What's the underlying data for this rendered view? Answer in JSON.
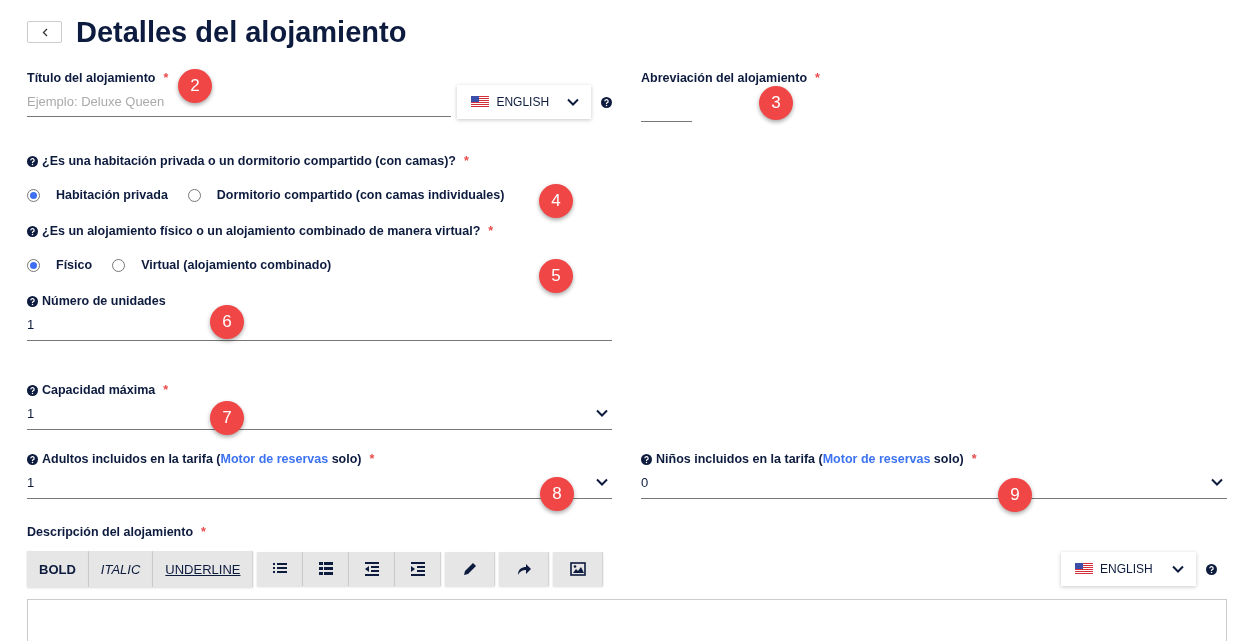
{
  "page": {
    "title": "Detalles del alojamiento"
  },
  "title_field": {
    "label": "Título del alojamiento",
    "required_mark": "*",
    "placeholder": "Ejemplo: Deluxe Queen",
    "language": "ENGLISH",
    "help_icon": true
  },
  "abbreviation_field": {
    "label": "Abreviación del alojamiento",
    "required_mark": "*"
  },
  "room_type": {
    "question": "¿Es una habitación privada o un dormitorio compartido (con camas)?",
    "required_mark": "*",
    "help_icon": true,
    "options": [
      {
        "label": "Habitación privada",
        "selected": true
      },
      {
        "label": "Dormitorio compartido (con camas individuales)",
        "selected": false
      }
    ]
  },
  "accommodation_type": {
    "question": "¿Es un alojamiento físico o un alojamiento combinado de manera virtual?",
    "required_mark": "*",
    "help_icon": true,
    "options": [
      {
        "label": "Físico",
        "selected": true
      },
      {
        "label": "Virtual (alojamiento combinado)",
        "selected": false
      }
    ]
  },
  "units_field": {
    "label": "Número de unidades",
    "help_icon": true,
    "value": "1"
  },
  "capacity_select": {
    "label": "Capacidad máxima",
    "required_mark": "*",
    "help_icon": true,
    "value": "1"
  },
  "adults_select": {
    "label_before": "Adultos incluidos en la tarifa (",
    "link": "Motor de reservas",
    "label_after": " solo)",
    "required_mark": "*",
    "help_icon": true,
    "value": "1"
  },
  "children_select": {
    "label_before": "Niños incluidos en la tarifa (",
    "link": "Motor de reservas",
    "label_after": " solo)",
    "required_mark": "*",
    "help_icon": true,
    "value": "0"
  },
  "description": {
    "label": "Descripción del alojamiento",
    "required_mark": "*",
    "language": "ENGLISH",
    "help_icon": true,
    "toolbar": [
      {
        "kind": "bold",
        "label": "BOLD"
      },
      {
        "kind": "italic",
        "label": "ITALIC"
      },
      {
        "kind": "underline",
        "label": "UNDERLINE"
      }
    ]
  },
  "annotations": [
    {
      "label": "2"
    },
    {
      "label": "3"
    },
    {
      "label": "4"
    },
    {
      "label": "5"
    },
    {
      "label": "6"
    },
    {
      "label": "7"
    },
    {
      "label": "8"
    },
    {
      "label": "9"
    }
  ]
}
